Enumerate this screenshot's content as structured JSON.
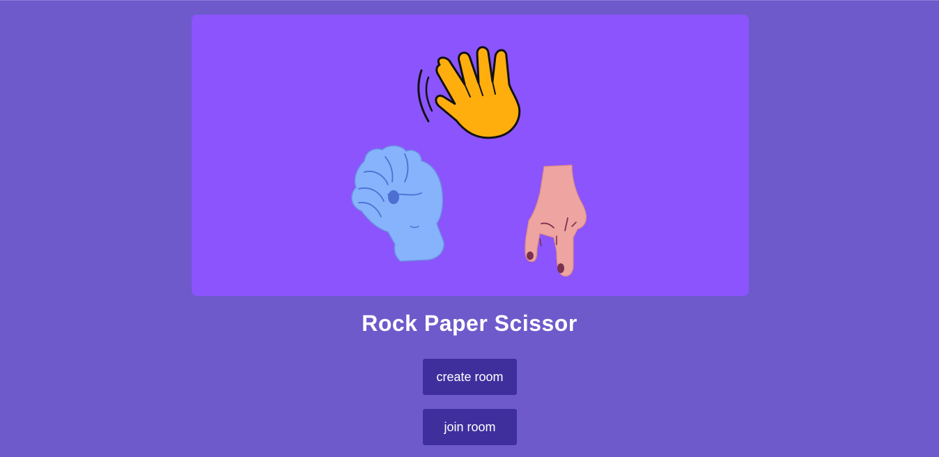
{
  "hero": {
    "image": "rock-paper-scissors-illustration",
    "background": "#8b54fd",
    "icons": {
      "paper": "waving-hand-icon",
      "rock": "fist-icon",
      "scissors": "two-finger-hand-icon"
    }
  },
  "title": "Rock Paper Scissor",
  "buttons": {
    "create_label": "create room",
    "join_label": "join room"
  },
  "colors": {
    "page_background": "#6e5acb",
    "button_background": "#3f2f9d",
    "paper_hand": "#ffae0d",
    "rock_hand": "#86b3fb",
    "scissors_hand": "#eea4a0"
  }
}
